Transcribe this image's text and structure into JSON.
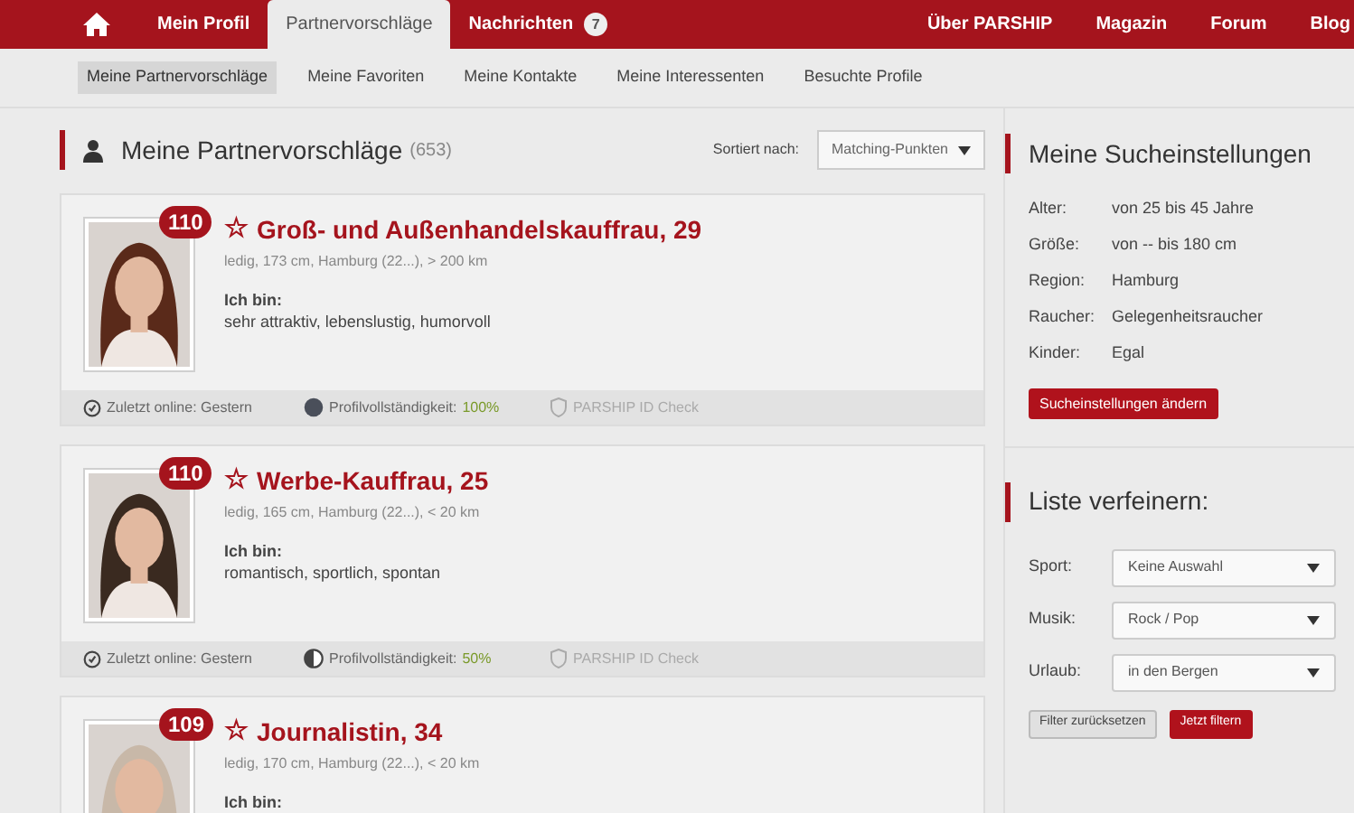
{
  "top_nav": {
    "left": [
      {
        "kind": "home",
        "selected": false
      },
      {
        "label": "Mein Profil",
        "selected": false
      },
      {
        "label": "Partnervorschläge",
        "selected": true
      },
      {
        "label": "Nachrichten",
        "badge": "7",
        "selected": false
      }
    ],
    "right": [
      {
        "label": "Über PARSHIP"
      },
      {
        "label": "Magazin"
      },
      {
        "label": "Forum"
      },
      {
        "label": "Blog"
      }
    ]
  },
  "sub_nav": [
    {
      "label": "Meine Partnervorschläge",
      "selected": true
    },
    {
      "label": "Meine Favoriten",
      "selected": false
    },
    {
      "label": "Meine Kontakte",
      "selected": false
    },
    {
      "label": "Meine Interessenten",
      "selected": false
    },
    {
      "label": "Besuchte Profile",
      "selected": false
    }
  ],
  "list": {
    "title": "Meine Partnervorschläge",
    "count": "(653)",
    "sort_label": "Sortiert nach:",
    "sort_value": "Matching-Punkten",
    "profiles": [
      {
        "score": "110",
        "star": "☆",
        "title": "Groß- und Außenhandelskauffrau, 29",
        "meta": "ledig, 173 cm, Hamburg (22...), > 200 km",
        "about_label": "Ich bin:",
        "about": "sehr attraktiv, lebenslustig, humorvoll",
        "footer": {
          "online": "Zuletzt online: Gestern",
          "completeness_label": "Profilvollständigkeit:",
          "completeness_value": "100%",
          "kind": "full",
          "id_check": "PARSHIP ID Check"
        }
      },
      {
        "score": "110",
        "star": "☆",
        "title": "Werbe-Kauffrau, 25",
        "meta": "ledig, 165 cm, Hamburg (22...), < 20 km",
        "about_label": "Ich bin:",
        "about": "romantisch, sportlich, spontan",
        "footer": {
          "online": "Zuletzt online: Gestern",
          "completeness_label": "Profilvollständigkeit:",
          "completeness_value": "50%",
          "kind": "half",
          "id_check": "PARSHIP ID Check"
        }
      },
      {
        "score": "109",
        "star": "☆",
        "title": "Journalistin, 34",
        "meta": "ledig, 170 cm, Hamburg (22...), < 20 km",
        "about_label": "Ich bin:"
      }
    ]
  },
  "search_settings": {
    "title": "Meine Sucheinstellungen",
    "rows": [
      {
        "label": "Alter:",
        "value": "von 25 bis 45 Jahre"
      },
      {
        "label": "Größe:",
        "value": "von -- bis 180 cm"
      },
      {
        "label": "Region:",
        "value": "Hamburg"
      },
      {
        "label": "Raucher:",
        "value": "Gelegenheitsraucher"
      },
      {
        "label": "Kinder:",
        "value": "Egal"
      }
    ],
    "button": "Sucheinstellungen ändern"
  },
  "refine": {
    "title": "Liste verfeinern:",
    "filters": [
      {
        "label": "Sport:",
        "value": "Keine Auswahl"
      },
      {
        "label": "Musik:",
        "value": "Rock / Pop"
      },
      {
        "label": "Urlaub:",
        "value": "in den Bergen"
      }
    ],
    "reset_button": "Filter zurücksetzen",
    "apply_button": "Jetzt filtern"
  }
}
